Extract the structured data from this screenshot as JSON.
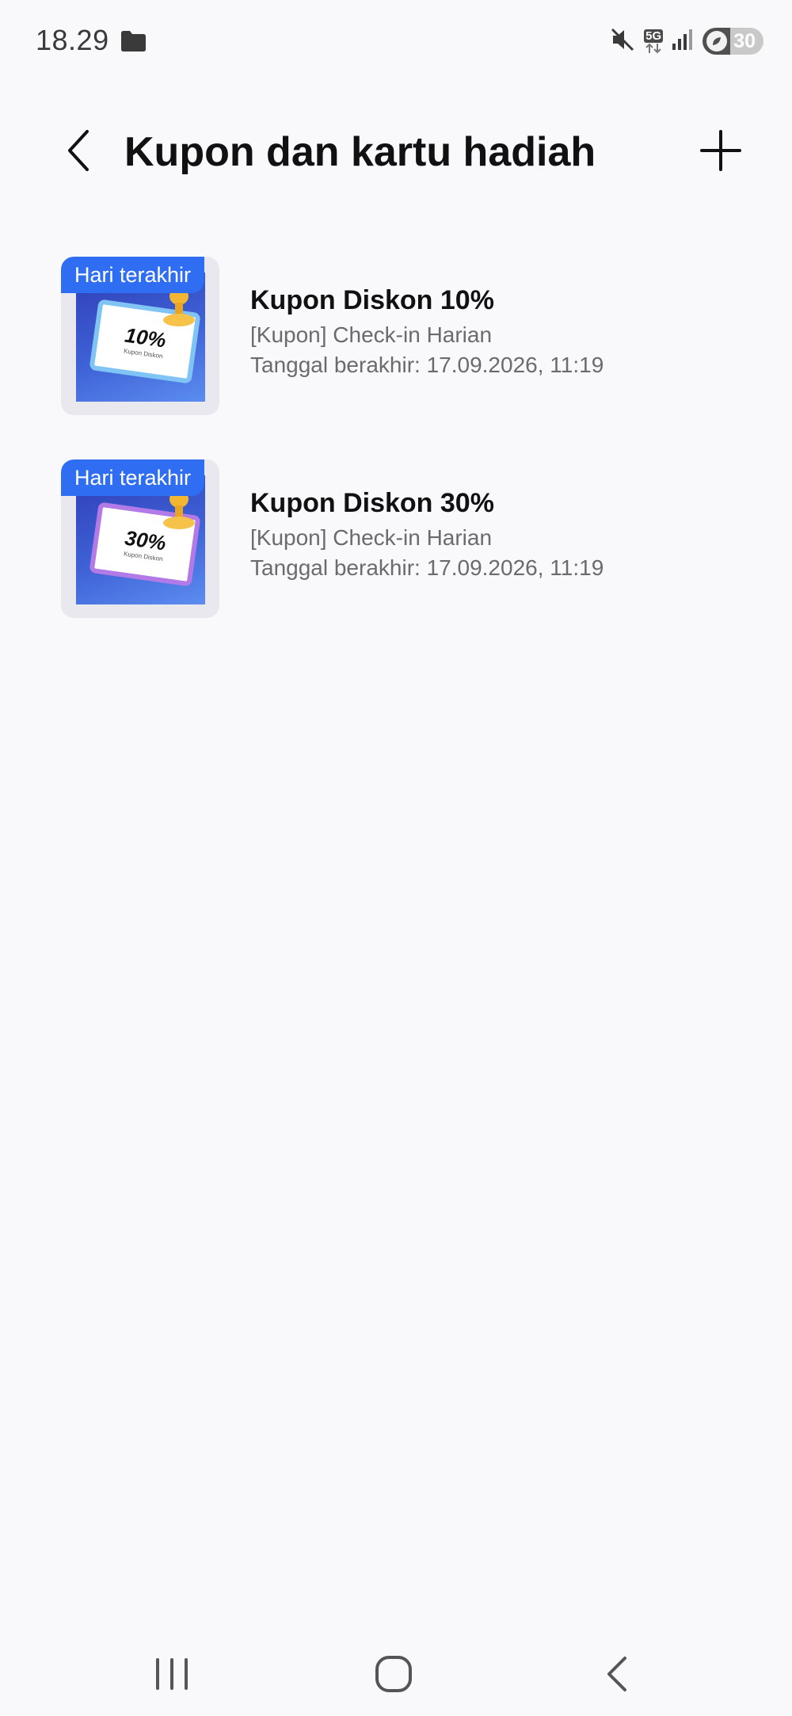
{
  "status_bar": {
    "time": "18.29",
    "network": "5G",
    "battery": "30",
    "icons": [
      "folder-icon",
      "mute-icon",
      "5g-icon",
      "signal-icon",
      "battery-icon"
    ]
  },
  "header": {
    "title": "Kupon dan kartu hadiah",
    "icons": [
      "back-arrow-icon",
      "plus-icon"
    ]
  },
  "coupons": [
    {
      "badge": "Hari terakhir",
      "name": "Kupon Diskon 10%",
      "source": "[Kupon] Check-in Harian",
      "expiry": "Tanggal berakhir: 17.09.2026, 11:19",
      "thumb_value": "10%",
      "thumb_caption": "Kupon Diskon"
    },
    {
      "badge": "Hari terakhir",
      "name": "Kupon Diskon 30%",
      "source": "[Kupon] Check-in Harian",
      "expiry": "Tanggal berakhir: 17.09.2026, 11:19",
      "thumb_value": "30%",
      "thumb_caption": "Kupon Diskon"
    }
  ],
  "nav_bar": {
    "icons": [
      "recents-icon",
      "home-icon",
      "back-icon"
    ]
  },
  "colors": {
    "background": "#f9f9fc",
    "badge": "#2f6ef2",
    "title": "#111111",
    "secondary_text": "#6b6b6b"
  }
}
